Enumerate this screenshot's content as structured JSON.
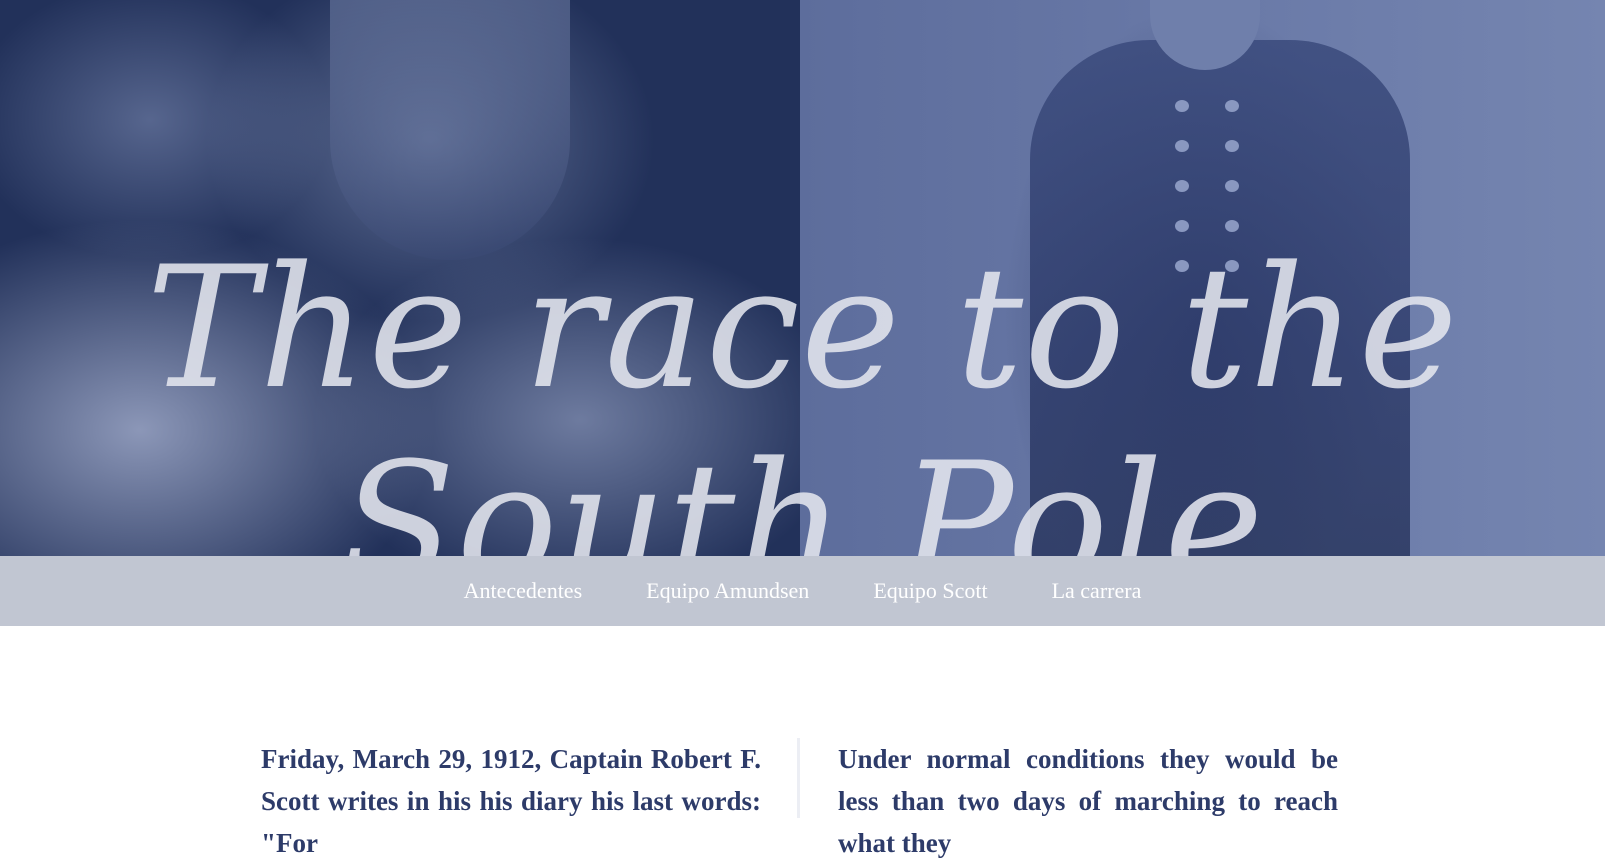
{
  "hero": {
    "title_line1": "The race to the",
    "title_line2": "South Pole"
  },
  "nav": {
    "items": [
      {
        "label": "Antecedentes"
      },
      {
        "label": "Equipo Amundsen"
      },
      {
        "label": "Equipo Scott"
      },
      {
        "label": "La carrera"
      }
    ]
  },
  "content": {
    "left_paragraph": "Friday, March 29, 1912, Captain Robert F. Scott writes in his his diary his last words: \"For",
    "right_paragraph": "Under normal conditions they would be less than two days of marching to reach what they"
  },
  "colors": {
    "hero_dark": "#22315a",
    "hero_light": "#6a7aa8",
    "nav_bg": "#c1c6d2",
    "text_accent": "#2d3b69"
  }
}
